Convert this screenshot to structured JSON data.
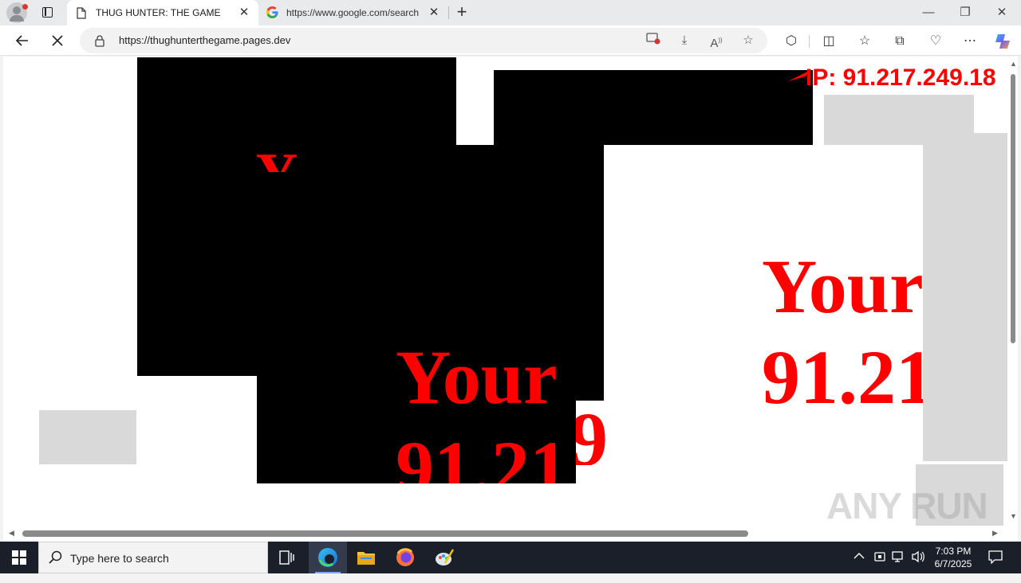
{
  "browser": {
    "tabs": [
      {
        "title": "THUG HUNTER: THE GAME",
        "active": true
      },
      {
        "title": "https://www.google.com/search",
        "active": false
      }
    ],
    "address": {
      "url": "https://thughunterthegame.pages.dev"
    },
    "controls": {
      "back": "back",
      "stop": "stop-loading",
      "new_tab": "+"
    }
  },
  "page": {
    "ip_banner": "IP: 91.217.249.18",
    "ip_stray": "9",
    "big_text_center": {
      "line1": "Your",
      "line2": "91.21"
    },
    "big_text_right": {
      "line1": "Your",
      "line2": "91.21"
    },
    "partial_glyph": "Y"
  },
  "watermark": "ANY RUN",
  "taskbar": {
    "search_placeholder": "Type here to search",
    "time": "7:03 PM",
    "date": "6/7/2025"
  },
  "colors": {
    "alarm_red": "#ff0000",
    "block_black": "#000000",
    "block_gray": "#d9d9d9",
    "taskbar_bg": "#1b1f2a"
  }
}
